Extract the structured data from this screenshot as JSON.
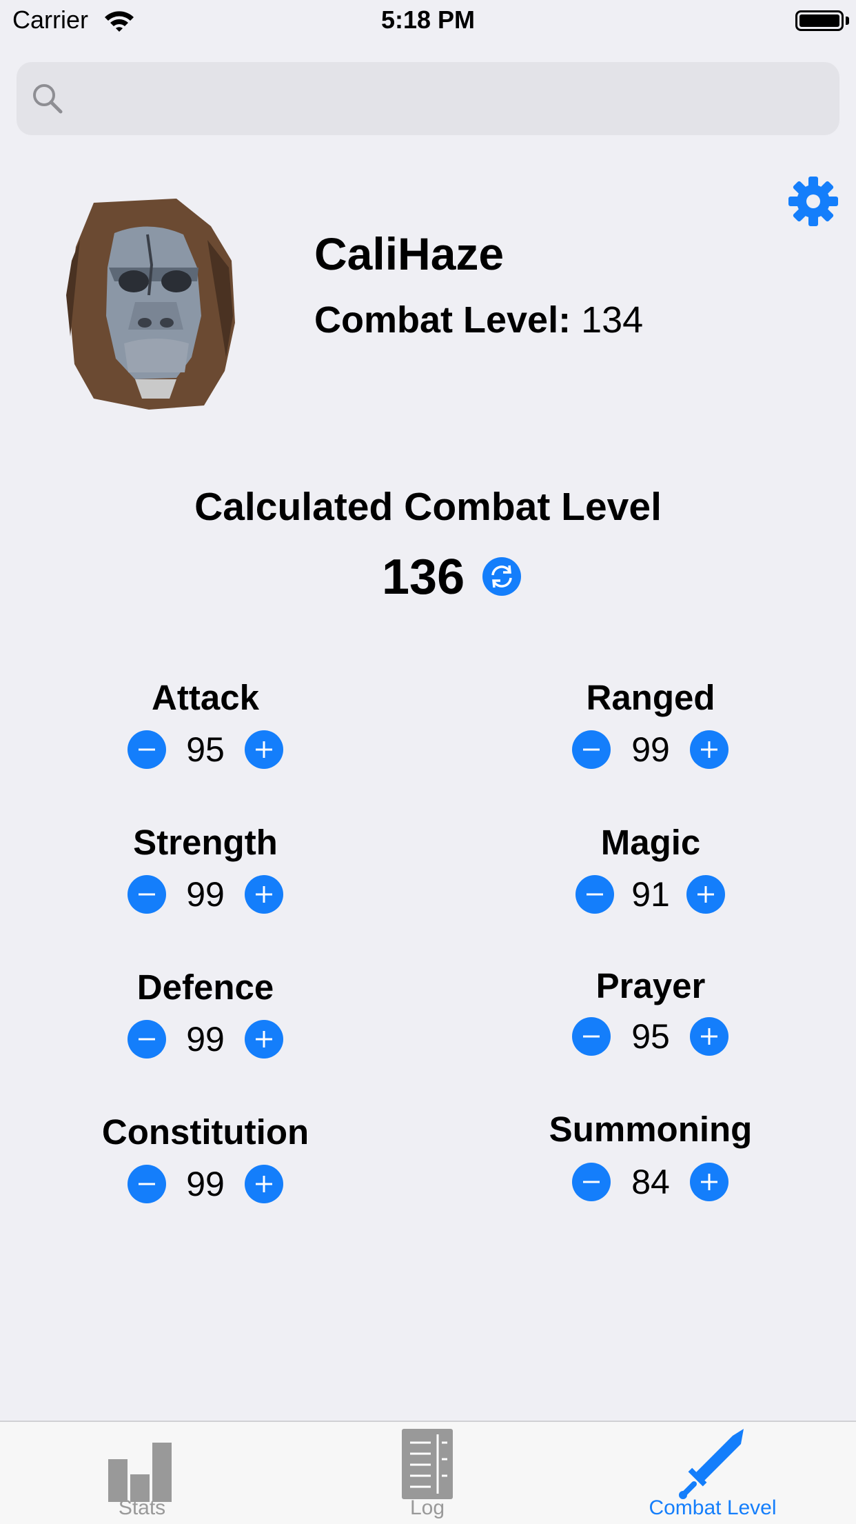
{
  "status_bar": {
    "carrier": "Carrier",
    "time": "5:18 PM"
  },
  "search": {
    "placeholder": "",
    "value": ""
  },
  "profile": {
    "name": "CaliHaze",
    "combat_level_label": "Combat Level:",
    "combat_level_value": "134"
  },
  "calculated": {
    "title": "Calculated Combat Level",
    "value": "136"
  },
  "skills": {
    "attack": {
      "label": "Attack",
      "value": "95"
    },
    "strength": {
      "label": "Strength",
      "value": "99"
    },
    "defence": {
      "label": "Defence",
      "value": "99"
    },
    "constitution": {
      "label": "Constitution",
      "value": "99"
    },
    "ranged": {
      "label": "Ranged",
      "value": "99"
    },
    "magic": {
      "label": "Magic",
      "value": "91"
    },
    "prayer": {
      "label": "Prayer",
      "value": "95"
    },
    "summoning": {
      "label": "Summoning",
      "value": "84"
    }
  },
  "tabs": [
    {
      "label": "Stats",
      "icon": "bar-chart-icon",
      "selected": false
    },
    {
      "label": "Log",
      "icon": "document-icon",
      "selected": false
    },
    {
      "label": "Combat Level",
      "icon": "sword-icon",
      "selected": true
    }
  ],
  "colors": {
    "accent": "#147efb",
    "inactive_tab": "#999999",
    "background": "#efeff4"
  }
}
